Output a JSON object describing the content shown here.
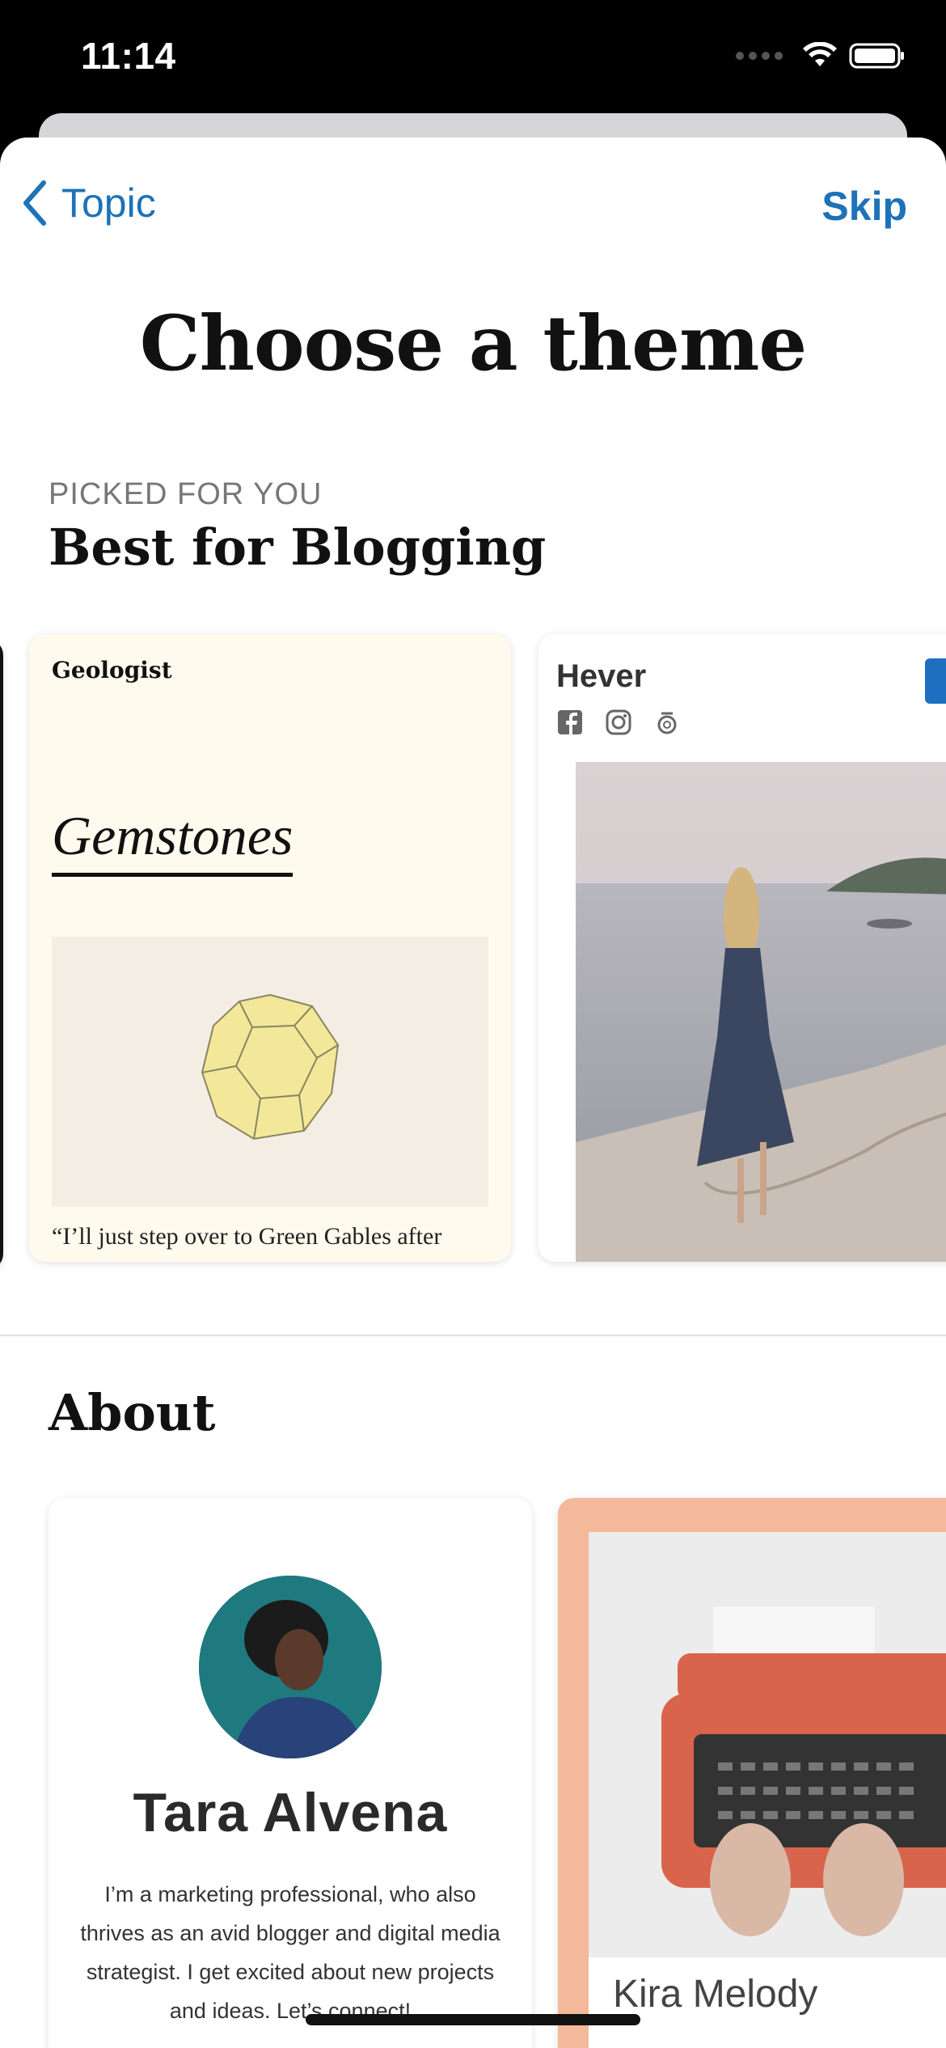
{
  "status_bar": {
    "time": "11:14"
  },
  "nav": {
    "back_label": "Topic",
    "skip_label": "Skip"
  },
  "page_title": "Choose a theme",
  "section_blogging": {
    "eyebrow": "PICKED FOR YOU",
    "title": "Best for Blogging",
    "cards": [
      {
        "brand": "Geologist",
        "heading": "Gemstones",
        "quote": "“I’ll just step over to Green Gables after"
      },
      {
        "brand": "Hever"
      }
    ]
  },
  "section_about": {
    "title": "About",
    "cards": [
      {
        "name": "Tara Alvena",
        "bio": "I’m a marketing professional, who also thrives as an avid blogger and digital media strategist. I get excited about new projects and ideas. Let’s connect!"
      },
      {
        "name": "Kira Melody"
      }
    ]
  },
  "colors": {
    "accent": "#1d72b8",
    "geologist_bg": "#fffaee",
    "kira_bg": "#f4b89a"
  },
  "icons": [
    "chevron-left-icon",
    "wifi-icon",
    "battery-icon",
    "facebook-icon",
    "instagram-icon",
    "fivehundredpx-icon"
  ]
}
